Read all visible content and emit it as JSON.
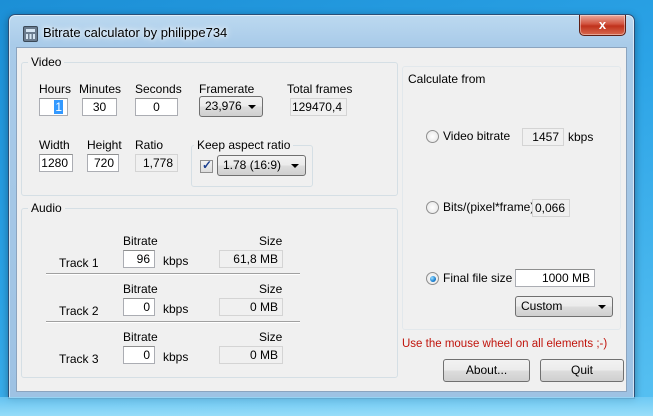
{
  "window": {
    "title": "Bitrate calculator by philippe734",
    "close_glyph": "x"
  },
  "video": {
    "group_label": "Video",
    "hours_label": "Hours",
    "hours_value": "1",
    "minutes_label": "Minutes",
    "minutes_value": "30",
    "seconds_label": "Seconds",
    "seconds_value": "0",
    "framerate_label": "Framerate",
    "framerate_value": "23,976",
    "total_frames_label": "Total frames",
    "total_frames_value": "129470,4",
    "width_label": "Width",
    "width_value": "1280",
    "height_label": "Height",
    "height_value": "720",
    "ratio_label": "Ratio",
    "ratio_value": "1,778",
    "keep_aspect_label": "Keep aspect ratio",
    "aspect_value": "1.78 (16:9)"
  },
  "audio": {
    "group_label": "Audio",
    "bitrate_header": "Bitrate",
    "size_header": "Size",
    "kbps_unit": "kbps",
    "tracks": [
      {
        "name": "Track 1",
        "bitrate": "96",
        "size": "61,8 MB"
      },
      {
        "name": "Track 2",
        "bitrate": "0",
        "size": "0 MB"
      },
      {
        "name": "Track 3",
        "bitrate": "0",
        "size": "0 MB"
      }
    ]
  },
  "calculate": {
    "group_label": "Calculate from",
    "video_bitrate_label": "Video bitrate",
    "video_bitrate_value": "1457",
    "video_bitrate_unit": "kbps",
    "bits_label": "Bits/(pixel*frame)",
    "bits_value": "0,066",
    "final_size_label": "Final file size",
    "final_size_value": "1000",
    "final_size_unit": "MB",
    "unit_combo_value": "Custom",
    "selected": "final_file_size"
  },
  "footer": {
    "hint": "Use the mouse wheel on all elements ;-)",
    "about_label": "About...",
    "quit_label": "Quit"
  }
}
